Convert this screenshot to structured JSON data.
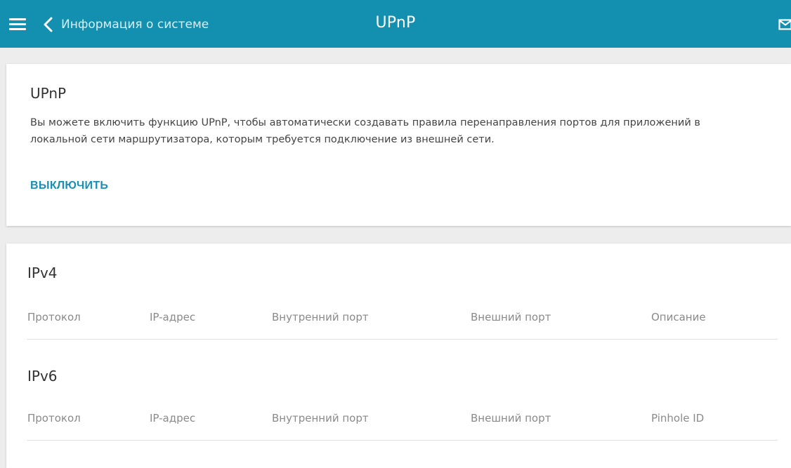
{
  "header": {
    "back_label": "Информация о системе",
    "title": "UPnP",
    "bar_color": "#138fb0",
    "icons": [
      "menu-icon",
      "chevron-left-icon",
      "mail-icon"
    ]
  },
  "upnp": {
    "title": "UPnP",
    "description": "Вы можете включить функцию UPnP, чтобы автоматически создавать правила перенаправления портов для приложений в локальной сети маршрутизатора, которым требуется подключение из внешней сети.",
    "action_label": "ВЫКЛЮЧИТЬ",
    "action_color": "#1a8fb5"
  },
  "ipv4": {
    "title": "IPv4",
    "columns": [
      "Протокол",
      "IP-адрес",
      "Внутренний порт",
      "Внешний порт",
      "Описание"
    ],
    "rows": []
  },
  "ipv6": {
    "title": "IPv6",
    "columns": [
      "Протокол",
      "IP-адрес",
      "Внутренний порт",
      "Внешний порт",
      "Pinhole ID"
    ],
    "rows": []
  }
}
